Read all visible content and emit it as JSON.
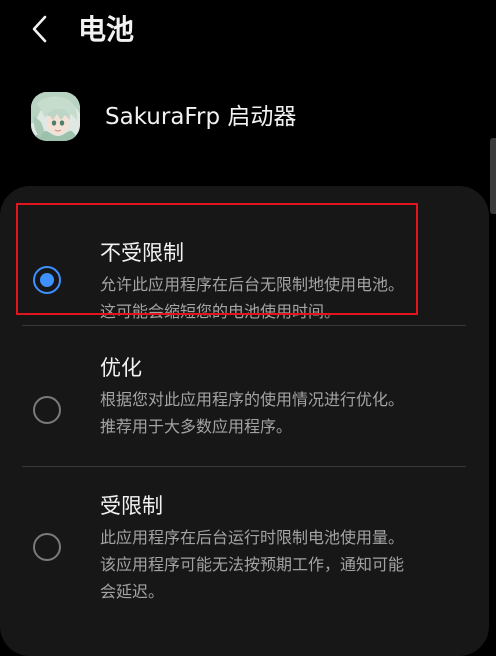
{
  "header": {
    "title": "电池"
  },
  "app": {
    "name": "SakuraFrp 启动器"
  },
  "options": [
    {
      "title": "不受限制",
      "description": "允许此应用程序在后台无限制地使用电池。这可能会缩短您的电池使用时间。",
      "selected": true
    },
    {
      "title": "优化",
      "description": "根据您对此应用程序的使用情况进行优化。推荐用于大多数应用程序。",
      "selected": false
    },
    {
      "title": "受限制",
      "description": "此应用程序在后台运行时限制电池使用量。该应用程序可能无法按预期工作，通知可能会延迟。",
      "selected": false
    }
  ],
  "colors": {
    "background": "#000000",
    "card": "#171717",
    "accent": "#3e91ff",
    "highlight": "#e3141d",
    "secondary_text": "#a3a3a3"
  }
}
